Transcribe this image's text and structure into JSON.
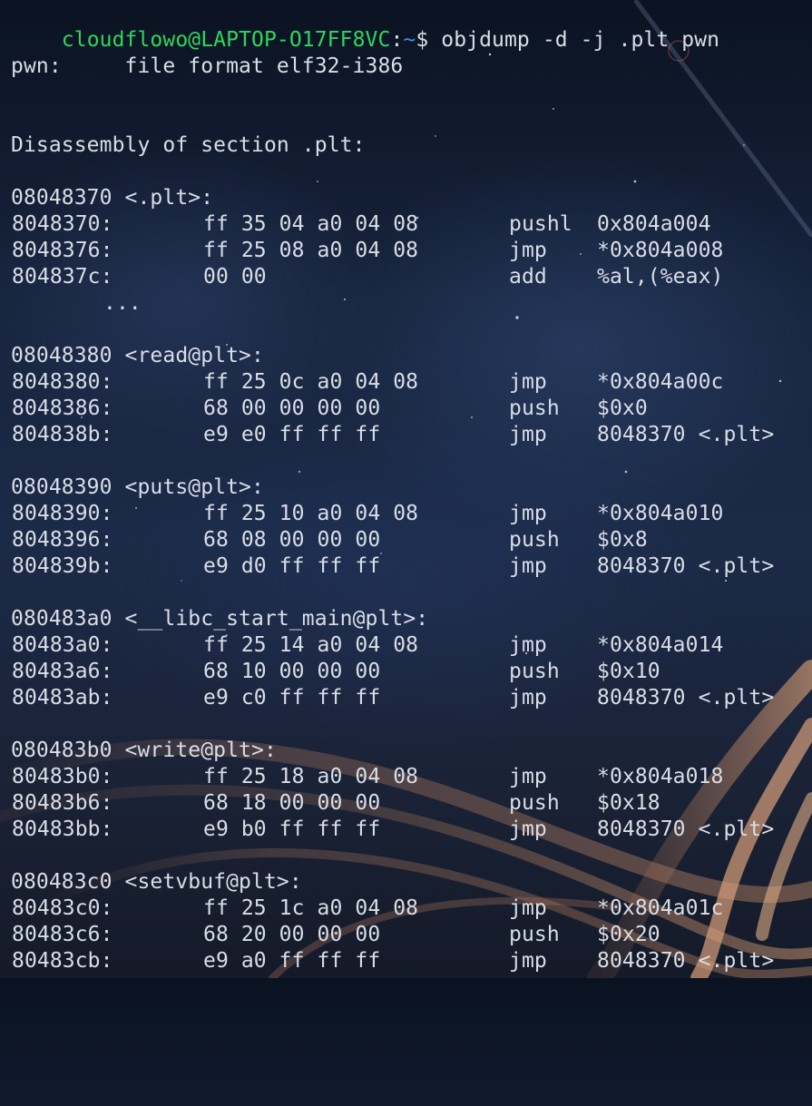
{
  "prompt": {
    "user_host": "cloudflowo@LAPTOP-O17FF8VC",
    "separator": ":",
    "path": "~",
    "symbol": "$ ",
    "command": "objdump -d -j .plt pwn"
  },
  "file_format_line": "pwn:     file format elf32-i386",
  "disassembly_header": "Disassembly of section .plt:",
  "sections": [
    {
      "label": "08048370 <.plt>:",
      "rows": [
        {
          "addr": "8048370:",
          "bytes": "ff 35 04 a0 04 08",
          "mnemonic": "pushl",
          "operand": "0x804a004"
        },
        {
          "addr": "8048376:",
          "bytes": "ff 25 08 a0 04 08",
          "mnemonic": "jmp",
          "operand": "*0x804a008"
        },
        {
          "addr": "804837c:",
          "bytes": "00 00",
          "mnemonic": "add",
          "operand": "%al,(%eax)"
        }
      ],
      "ellipsis": "..."
    },
    {
      "label": "08048380 <read@plt>:",
      "rows": [
        {
          "addr": "8048380:",
          "bytes": "ff 25 0c a0 04 08",
          "mnemonic": "jmp",
          "operand": "*0x804a00c"
        },
        {
          "addr": "8048386:",
          "bytes": "68 00 00 00 00",
          "mnemonic": "push",
          "operand": "$0x0"
        },
        {
          "addr": "804838b:",
          "bytes": "e9 e0 ff ff ff",
          "mnemonic": "jmp",
          "operand": "8048370 <.plt>"
        }
      ]
    },
    {
      "label": "08048390 <puts@plt>:",
      "rows": [
        {
          "addr": "8048390:",
          "bytes": "ff 25 10 a0 04 08",
          "mnemonic": "jmp",
          "operand": "*0x804a010"
        },
        {
          "addr": "8048396:",
          "bytes": "68 08 00 00 00",
          "mnemonic": "push",
          "operand": "$0x8"
        },
        {
          "addr": "804839b:",
          "bytes": "e9 d0 ff ff ff",
          "mnemonic": "jmp",
          "operand": "8048370 <.plt>"
        }
      ]
    },
    {
      "label": "080483a0 <__libc_start_main@plt>:",
      "rows": [
        {
          "addr": "80483a0:",
          "bytes": "ff 25 14 a0 04 08",
          "mnemonic": "jmp",
          "operand": "*0x804a014"
        },
        {
          "addr": "80483a6:",
          "bytes": "68 10 00 00 00",
          "mnemonic": "push",
          "operand": "$0x10"
        },
        {
          "addr": "80483ab:",
          "bytes": "e9 c0 ff ff ff",
          "mnemonic": "jmp",
          "operand": "8048370 <.plt>"
        }
      ]
    },
    {
      "label": "080483b0 <write@plt>:",
      "rows": [
        {
          "addr": "80483b0:",
          "bytes": "ff 25 18 a0 04 08",
          "mnemonic": "jmp",
          "operand": "*0x804a018"
        },
        {
          "addr": "80483b6:",
          "bytes": "68 18 00 00 00",
          "mnemonic": "push",
          "operand": "$0x18"
        },
        {
          "addr": "80483bb:",
          "bytes": "e9 b0 ff ff ff",
          "mnemonic": "jmp",
          "operand": "8048370 <.plt>"
        }
      ]
    },
    {
      "label": "080483c0 <setvbuf@plt>:",
      "rows": [
        {
          "addr": "80483c0:",
          "bytes": "ff 25 1c a0 04 08",
          "mnemonic": "jmp",
          "operand": "*0x804a01c"
        },
        {
          "addr": "80483c6:",
          "bytes": "68 20 00 00 00",
          "mnemonic": "push",
          "operand": "$0x20"
        },
        {
          "addr": "80483cb:",
          "bytes": "e9 a0 ff ff ff",
          "mnemonic": "jmp",
          "operand": "8048370 <.plt>"
        }
      ]
    }
  ],
  "colors": {
    "user_host": "#2fd65a",
    "path": "#3b8eea",
    "text": "#d9dde6"
  }
}
